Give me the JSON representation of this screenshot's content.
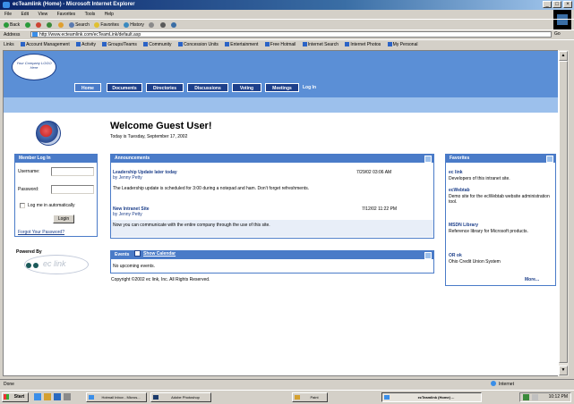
{
  "window": {
    "title": "ecTeamlink (Home) - Microsoft Internet Explorer",
    "controls": [
      "_",
      "□",
      "×"
    ]
  },
  "menu": [
    "File",
    "Edit",
    "View",
    "Favorites",
    "Tools",
    "Help"
  ],
  "toolbar": {
    "back": "Back",
    "search": "Search",
    "favorites": "Favorites",
    "history": "History"
  },
  "address": {
    "label": "Address",
    "value": "http://www.ecteamlink.com/ecTeamLink/default.asp",
    "go": "Go"
  },
  "links_bar": {
    "label": "Links",
    "items": [
      "Account Management",
      "Activity",
      "Groups/Teams",
      "Community",
      "Concession Units",
      "Entertainment",
      "Free Hotmail",
      "Internet Search",
      "Internet Photos",
      "My Personal"
    ]
  },
  "site": {
    "logo": "Your Company LOGO Here",
    "tabs": [
      "Home",
      "Documents",
      "Directories",
      "Discussions",
      "Voting",
      "Meetings"
    ],
    "login_link": "Log In",
    "welcome": "Welcome Guest User!",
    "date": "Today is Tuesday, September 17, 2002"
  },
  "member_login": {
    "title": "Member Log In",
    "username_label": "Username:",
    "password_label": "Password:",
    "remember_label": "Log me in automatically",
    "login_button": "Login",
    "forgot": "Forgot Your Password?"
  },
  "powered_by": {
    "label": "Powered By",
    "brand": "ec link"
  },
  "announcements": {
    "title": "Announcements",
    "items": [
      {
        "title": "Leadership Update later today",
        "author": "by Jenny Petty",
        "date": "7/29/02 03:06 AM",
        "body": "The Leadership update is scheduled for 3:00 during a notepad and ham. Don't forget refreshments."
      },
      {
        "title": "New Intranet Site",
        "author": "by Jenny Petty",
        "date": "7/12/02 11:22 PM",
        "body": "Now you can communicate with the entire company through the use of this site."
      }
    ]
  },
  "events": {
    "title": "Events",
    "calendar_link": "Show Calendar",
    "empty": "No upcoming events."
  },
  "copyright": "Copyright ©2002 ec link, Inc. All Rights Reserved.",
  "favorites": {
    "title": "Favorites",
    "items": [
      {
        "title": "ec link",
        "desc": "Developers of this intranet site."
      },
      {
        "title": "ecWebtab",
        "desc": "Demo site for the ecWebtab website administration tool."
      },
      {
        "title": "MSDN Library",
        "desc": "Reference library for Microsoft products."
      },
      {
        "title": "OR ok",
        "desc": "Ohio Credit Union System"
      }
    ],
    "more": "More..."
  },
  "status": {
    "left": "Done",
    "zone": "Internet"
  },
  "taskbar": {
    "start": "Start",
    "items": [
      "Hotmail Inbox - Micros...",
      "Adobe Photoshop",
      "Paint",
      "ecTeamlink (Home) ..."
    ],
    "clock": "10:12 PM"
  },
  "colors": {
    "nav_dark": "#1d3f8a",
    "nav_band": "#5b8fd6",
    "nav_light": "#9cc0ec",
    "panel_header": "#4a7bc8"
  }
}
